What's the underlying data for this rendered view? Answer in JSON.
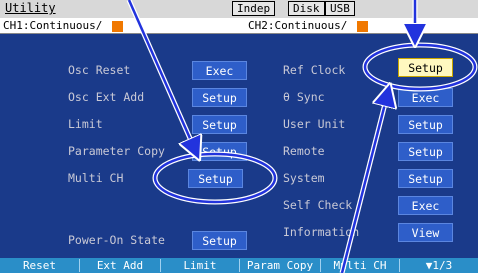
{
  "topbar": {
    "title": "Utility",
    "indep": "Indep",
    "disk": "Disk",
    "usb": "USB"
  },
  "channels": {
    "ch1": "CH1:Continuous/",
    "ch2": "CH2:Continuous/"
  },
  "left_items": [
    {
      "label": "Osc Reset",
      "button": "Exec"
    },
    {
      "label": "Osc Ext Add",
      "button": "Setup"
    },
    {
      "label": "Limit",
      "button": "Setup"
    },
    {
      "label": "Parameter Copy",
      "button": "Setup"
    },
    {
      "label": "Multi CH",
      "button": "Setup"
    },
    {
      "label": "Power-On State",
      "button": "Setup"
    }
  ],
  "right_items": [
    {
      "label": "Ref Clock",
      "button": "Setup"
    },
    {
      "label": "θ Sync",
      "button": "Exec"
    },
    {
      "label": "User Unit",
      "button": "Setup"
    },
    {
      "label": "Remote",
      "button": "Setup"
    },
    {
      "label": "System",
      "button": "Setup"
    },
    {
      "label": "Self Check",
      "button": "Exec"
    },
    {
      "label": "Information",
      "button": "View"
    }
  ],
  "softkeys": [
    "Reset",
    "Ext Add",
    "Limit",
    "Param Copy",
    "Multi CH",
    "▼1/3"
  ],
  "colors": {
    "panel_bg": "#1a3a8a",
    "button_bg": "#2e5ec9",
    "selected_button_bg": "#fff8c0",
    "softkey_bg": "#2a8ec8",
    "channel_marker": "#f07800",
    "annotation": "#2233dd"
  }
}
